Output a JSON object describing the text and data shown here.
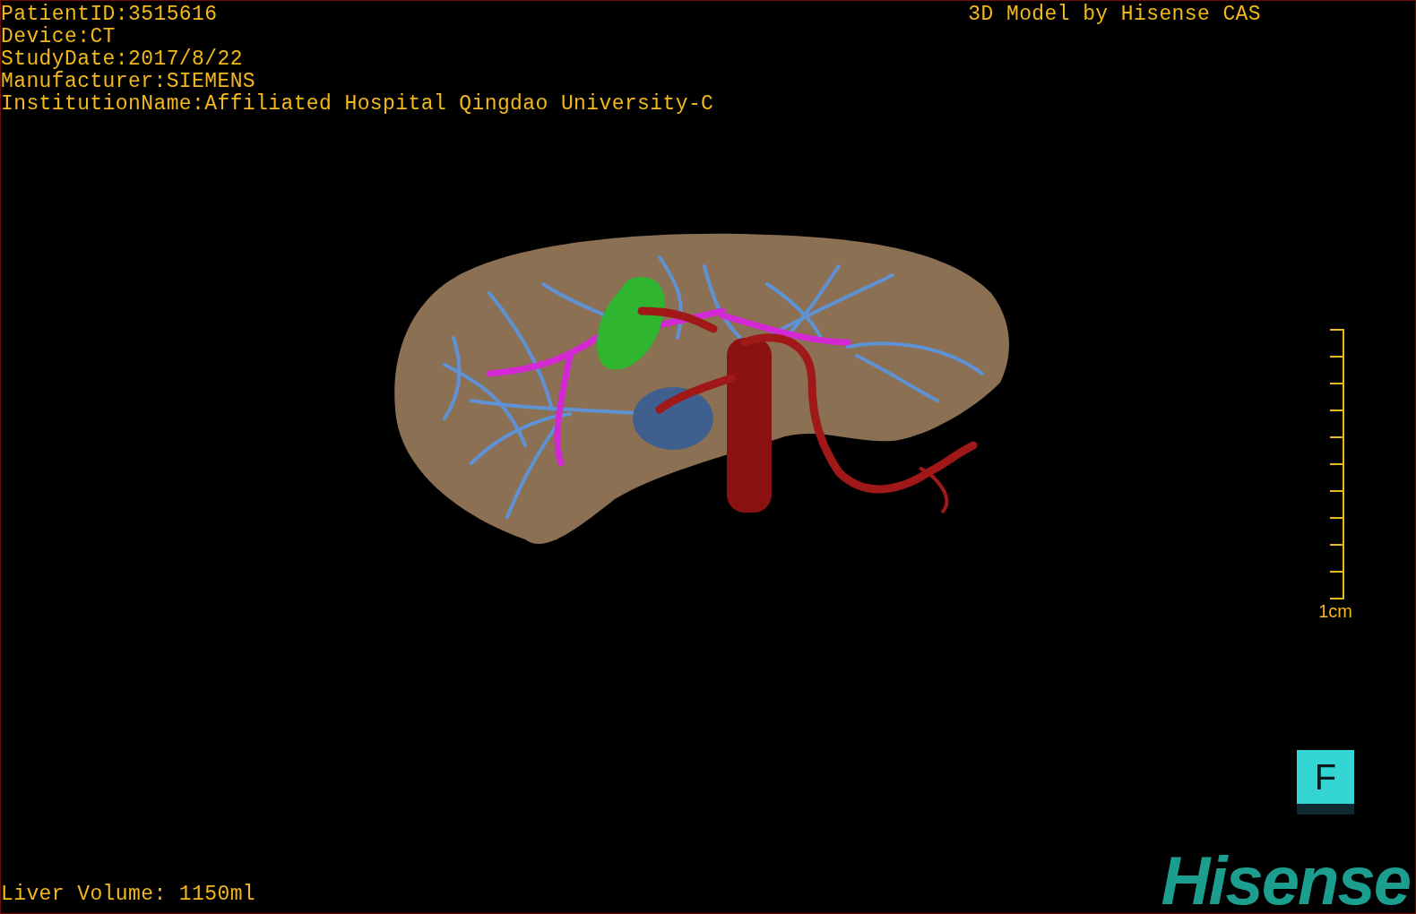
{
  "patient_info": [
    "PatientID:3515616",
    "Device:CT",
    "StudyDate:2017/8/22",
    "Manufacturer:SIEMENS",
    "InstitutionName:Affiliated Hospital Qingdao University-C"
  ],
  "title": "3D Model by Hisense CAS",
  "scale_label": "1cm",
  "view_button": "F",
  "liver_volume": "Liver Volume: 1150ml",
  "logo": "Hisense"
}
